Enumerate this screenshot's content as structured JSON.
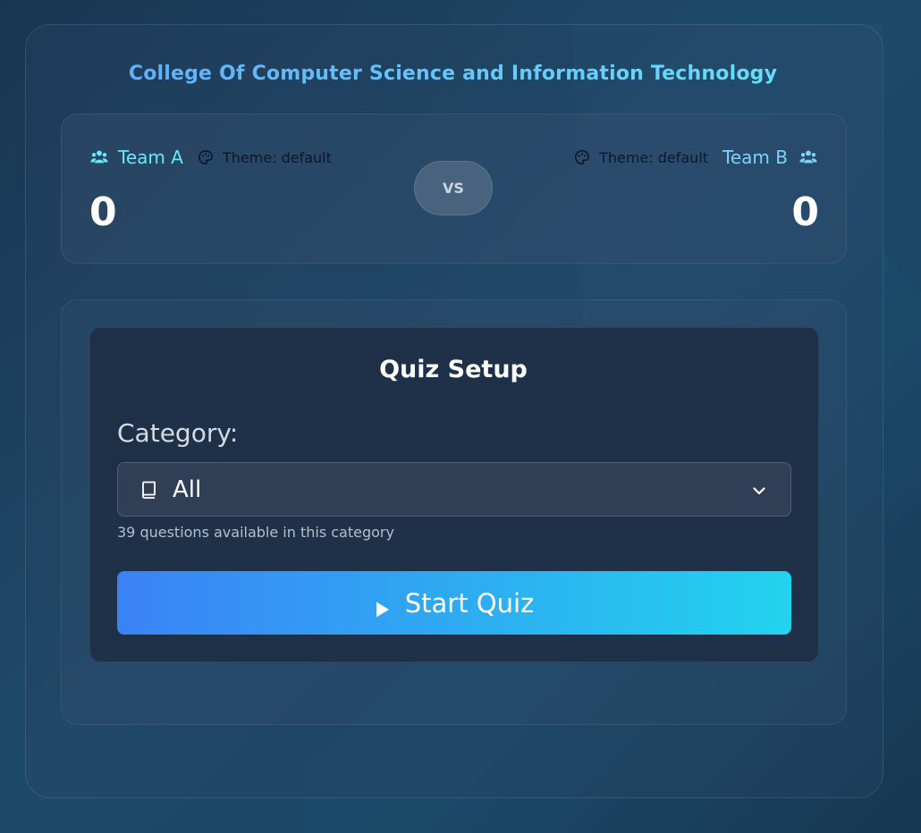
{
  "header": {
    "college_title": "College Of Computer Science and Information Technology"
  },
  "scoreboard": {
    "team_a": {
      "name": "Team A",
      "theme": "Theme: default",
      "score": "0",
      "icon": "users-icon"
    },
    "team_b": {
      "name": "Team B",
      "theme": "Theme: default",
      "score": "0",
      "icon": "users-icon"
    },
    "vs_label": "VS"
  },
  "quiz_setup": {
    "title": "Quiz Setup",
    "category_label": "Category:",
    "category_selected": "All",
    "category_icon": "book-icon",
    "question_count_text": "39 questions available in this category",
    "start_button_label": "Start Quiz",
    "start_button_icon": "play-icon"
  },
  "colors": {
    "accent_blue": "#3b82f6",
    "accent_cyan": "#22d3ee",
    "team_name": "#67e8f9"
  }
}
